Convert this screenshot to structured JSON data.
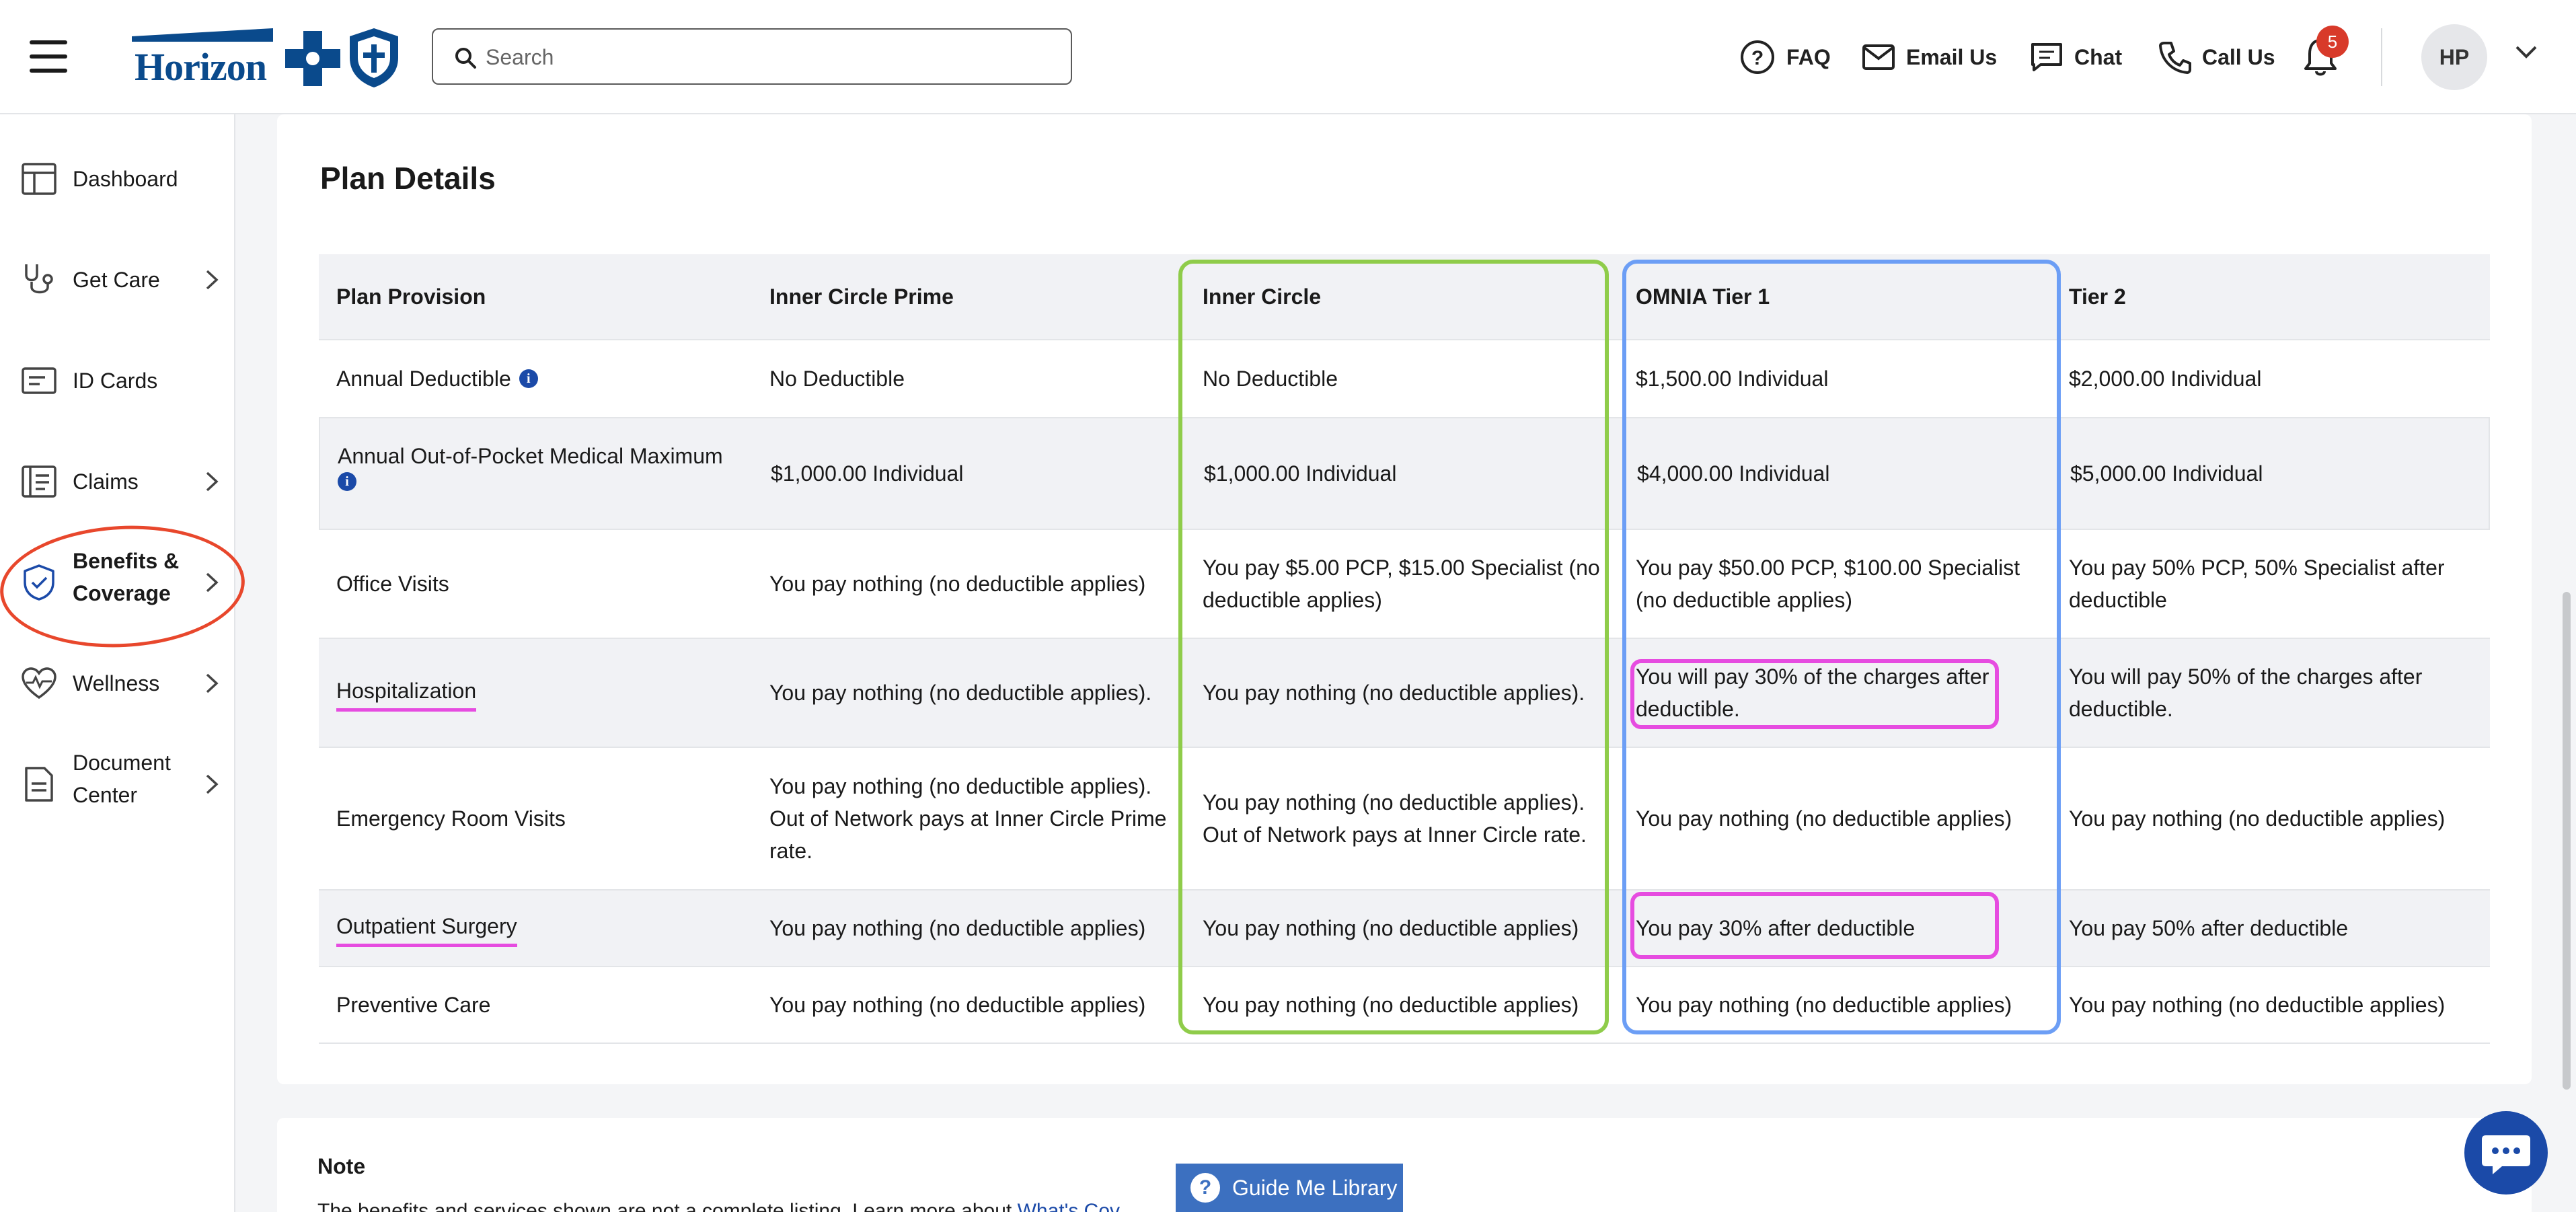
{
  "header": {
    "brand": "Horizon",
    "search_placeholder": "Search",
    "nav": [
      {
        "label": "FAQ",
        "icon": "question-circle-icon"
      },
      {
        "label": "Email Us",
        "icon": "envelope-icon"
      },
      {
        "label": "Chat",
        "icon": "chat-bubble-icon"
      },
      {
        "label": "Call Us",
        "icon": "phone-icon"
      }
    ],
    "notification_count": "5",
    "avatar_initials": "HP"
  },
  "sidebar": {
    "items": [
      {
        "label": "Dashboard",
        "icon": "dashboard-icon",
        "has_chevron": false
      },
      {
        "label": "Get Care",
        "icon": "stethoscope-icon",
        "has_chevron": true
      },
      {
        "label": "ID Cards",
        "icon": "id-card-icon",
        "has_chevron": false
      },
      {
        "label": "Claims",
        "icon": "claims-icon",
        "has_chevron": true
      },
      {
        "label": "Benefits &",
        "label2": "Coverage",
        "icon": "shield-check-icon",
        "has_chevron": true,
        "active": true
      },
      {
        "label": "Wellness",
        "icon": "heart-pulse-icon",
        "has_chevron": true
      },
      {
        "label": "Document",
        "label2": "Center",
        "icon": "document-icon",
        "has_chevron": true
      }
    ]
  },
  "plan": {
    "title": "Plan Details",
    "headers": [
      "Plan Provision",
      "Inner Circle Prime",
      "Inner Circle",
      "OMNIA Tier 1",
      "Tier 2"
    ],
    "rows": [
      [
        "Annual Deductible",
        "No Deductible",
        "No Deductible",
        "$1,500.00 Individual",
        "$2,000.00 Individual"
      ],
      [
        "Annual Out-of-Pocket Medical Maximum",
        "$1,000.00 Individual",
        "$1,000.00 Individual",
        "$4,000.00 Individual",
        "$5,000.00 Individual"
      ],
      [
        "Office Visits",
        "You pay nothing (no deductible applies)",
        "You pay $5.00 PCP, $15.00 Specialist (no deductible applies)",
        "You pay $50.00 PCP, $100.00 Specialist (no deductible applies)",
        "You pay 50% PCP, 50% Specialist after deductible"
      ],
      [
        "Hospitalization",
        "You pay nothing (no deductible applies).",
        "You pay nothing (no deductible applies).",
        "You will pay 30% of the charges after deductible.",
        "You will pay 50% of the charges after deductible."
      ],
      [
        "Emergency Room Visits",
        "You pay nothing (no deductible applies). Out of Network pays at Inner Circle Prime rate.",
        "You pay nothing (no deductible applies). Out of Network pays at Inner Circle rate.",
        "You pay nothing (no deductible applies)",
        "You pay nothing (no deductible applies)"
      ],
      [
        "Outpatient Surgery",
        "You pay nothing (no deductible applies)",
        "You pay nothing (no deductible applies)",
        "You pay 30% after deductible",
        "You pay 50% after deductible"
      ],
      [
        "Preventive Care",
        "You pay nothing (no deductible applies)",
        "You pay nothing (no deductible applies)",
        "You pay nothing (no deductible applies)",
        "You pay nothing (no deductible applies)"
      ]
    ]
  },
  "note": {
    "title": "Note",
    "text": "The benefits and services shown are not a complete listing. Learn more about ",
    "link": "What's Cov"
  },
  "guide_button": "Guide Me Library",
  "colors": {
    "brand": "#0a4a8c",
    "accent": "#1b4aa8",
    "badge": "#d83a2a"
  }
}
